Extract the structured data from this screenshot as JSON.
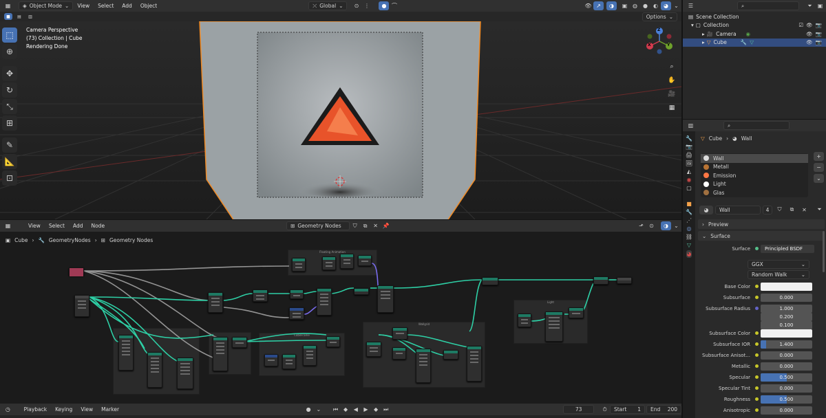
{
  "top_header": {
    "mode": "Object Mode",
    "menus": [
      "View",
      "Select",
      "Add",
      "Object"
    ],
    "orientation": "Global",
    "options": "Options"
  },
  "viewport": {
    "info_line1": "Camera Perspective",
    "info_line2": "(73) Collection | Cube",
    "info_line3": "Rendering Done",
    "gizmo": {
      "z": "Z",
      "x": "X",
      "y": "Y"
    }
  },
  "outliner": {
    "root": "Scene Collection",
    "collection": "Collection",
    "items": [
      {
        "label": "Camera",
        "selected": false
      },
      {
        "label": "Cube",
        "selected": true
      }
    ]
  },
  "properties": {
    "object_name": "Cube",
    "material_name": "Wall",
    "materials": [
      {
        "label": "Wall",
        "color": "#dcdcdc",
        "active": true
      },
      {
        "label": "Metall",
        "color": "#b87333",
        "active": false
      },
      {
        "label": "Emission",
        "color": "#ff7744",
        "active": false
      },
      {
        "label": "Light",
        "color": "#ffffff",
        "active": false
      },
      {
        "label": "Glas",
        "color": "#a07040",
        "active": false
      }
    ],
    "slot_name": "Wall",
    "user_count": "4",
    "sections": {
      "preview": "Preview",
      "surface": "Surface"
    },
    "surface_label": "Surface",
    "surface_value": "Principled BSDF",
    "distribution": "GGX",
    "subsurface_method": "Random Walk",
    "rows": [
      {
        "label": "Base Color",
        "type": "color",
        "color": "#f0f0f0"
      },
      {
        "label": "Subsurface",
        "type": "value",
        "value": "0.000",
        "fill": 0
      },
      {
        "label": "Subsurface Radius",
        "type": "value",
        "value": "1.000",
        "fill": 0
      },
      {
        "label": "",
        "type": "value",
        "value": "0.200",
        "fill": 0
      },
      {
        "label": "",
        "type": "value",
        "value": "0.100",
        "fill": 0
      },
      {
        "label": "Subsurface Color",
        "type": "color",
        "color": "#f0f0f0"
      },
      {
        "label": "Subsurface IOR",
        "type": "value",
        "value": "1.400",
        "fill": 0.1
      },
      {
        "label": "Subsurface Anisot...",
        "type": "value",
        "value": "0.000",
        "fill": 0
      },
      {
        "label": "Metallic",
        "type": "value",
        "value": "0.000",
        "fill": 0
      },
      {
        "label": "Specular",
        "type": "value",
        "value": "0.500",
        "fill": 0.5
      },
      {
        "label": "Specular Tint",
        "type": "value",
        "value": "0.000",
        "fill": 0
      },
      {
        "label": "Roughness",
        "type": "value",
        "value": "0.500",
        "fill": 0.5
      },
      {
        "label": "Anisotropic",
        "type": "value",
        "value": "0.000",
        "fill": 0
      }
    ]
  },
  "node_editor": {
    "menus": [
      "View",
      "Select",
      "Add",
      "Node"
    ],
    "tree_name": "Geometry Nodes",
    "breadcrumb": [
      "Cube",
      "GeometryNodes",
      "Geometry Nodes"
    ],
    "frames": [
      "Floating Animation",
      "CubeFrame",
      "Wallgrid",
      "Light"
    ]
  },
  "timeline": {
    "menus": [
      "Playback",
      "Keying",
      "View",
      "Marker"
    ],
    "current_frame": "73",
    "start_label": "Start",
    "start": "1",
    "end_label": "End",
    "end": "200"
  },
  "colors": {
    "accent": "#4772b3",
    "selection": "#f08a24",
    "node_link": "#30c8a0"
  }
}
